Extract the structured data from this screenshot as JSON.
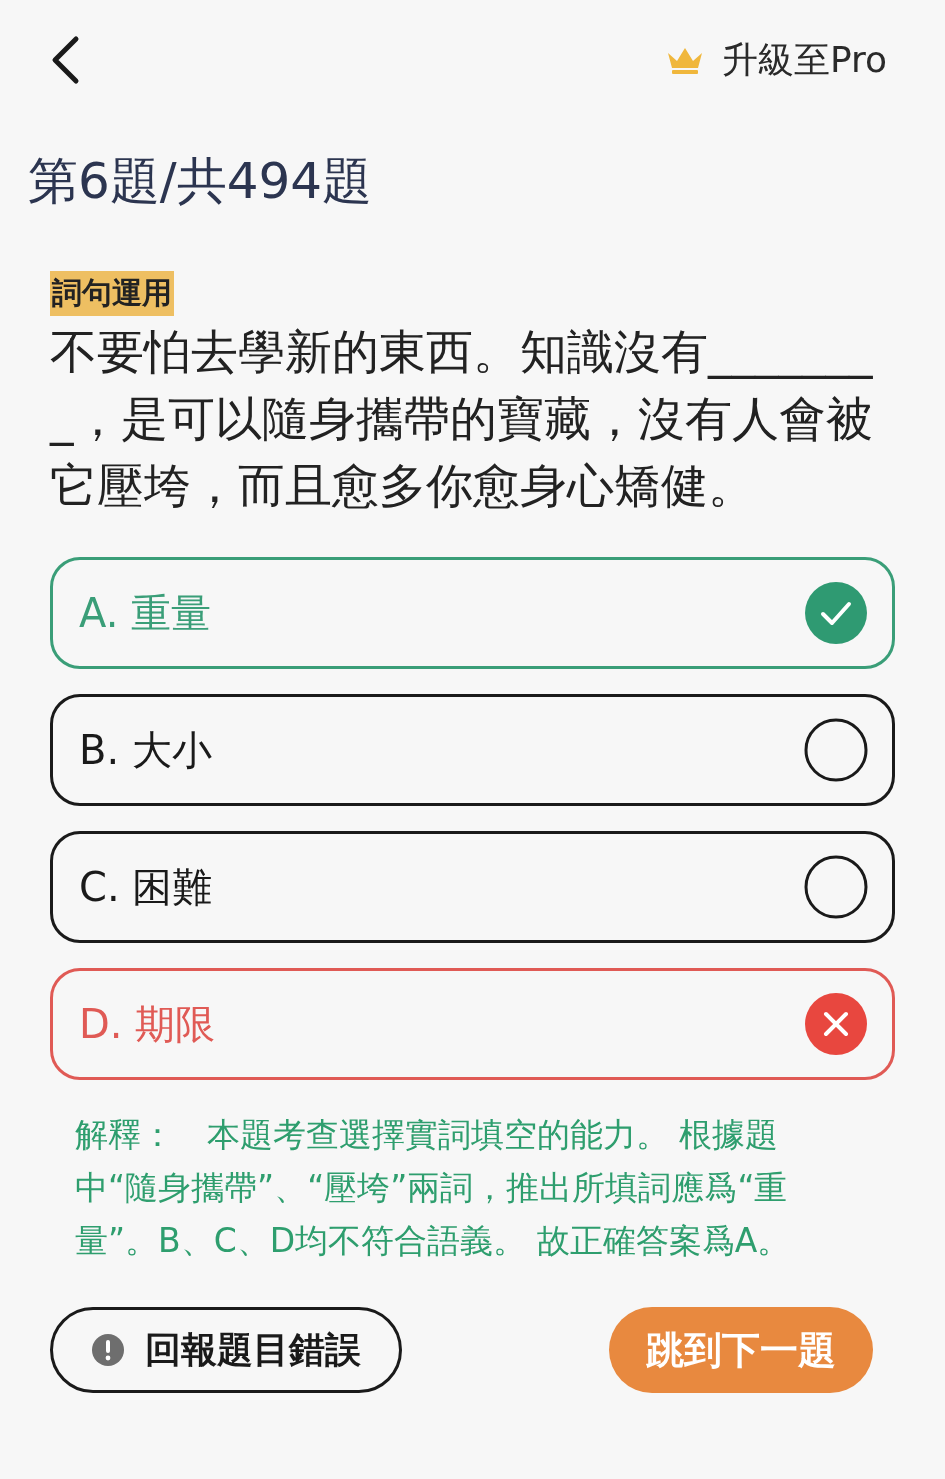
{
  "header": {
    "upgrade_label": "升級至Pro"
  },
  "progress": "第6題/共494題",
  "question": {
    "tag": "詞句運用",
    "text": "不要怕去學新的東西。知識沒有________，是可以隨身攜帶的寶藏，沒有人會被它壓垮，而且愈多你愈身心矯健。"
  },
  "options": [
    {
      "letter": "A.",
      "text": "重量",
      "kind": "correct"
    },
    {
      "letter": "B.",
      "text": "大小",
      "kind": "neutral"
    },
    {
      "letter": "C.",
      "text": "困難",
      "kind": "neutral"
    },
    {
      "letter": "D.",
      "text": "期限",
      "kind": "wrong"
    }
  ],
  "explanation": "解釋：　本題考查選擇實詞填空的能力。 根據題中“隨身攜帶”、“壓垮”兩詞，推出所填詞應爲“重量”。B、C、D均不符合語義。 故正確答案爲A。",
  "buttons": {
    "report": "回報題目錯誤",
    "next": "跳到下一題"
  }
}
